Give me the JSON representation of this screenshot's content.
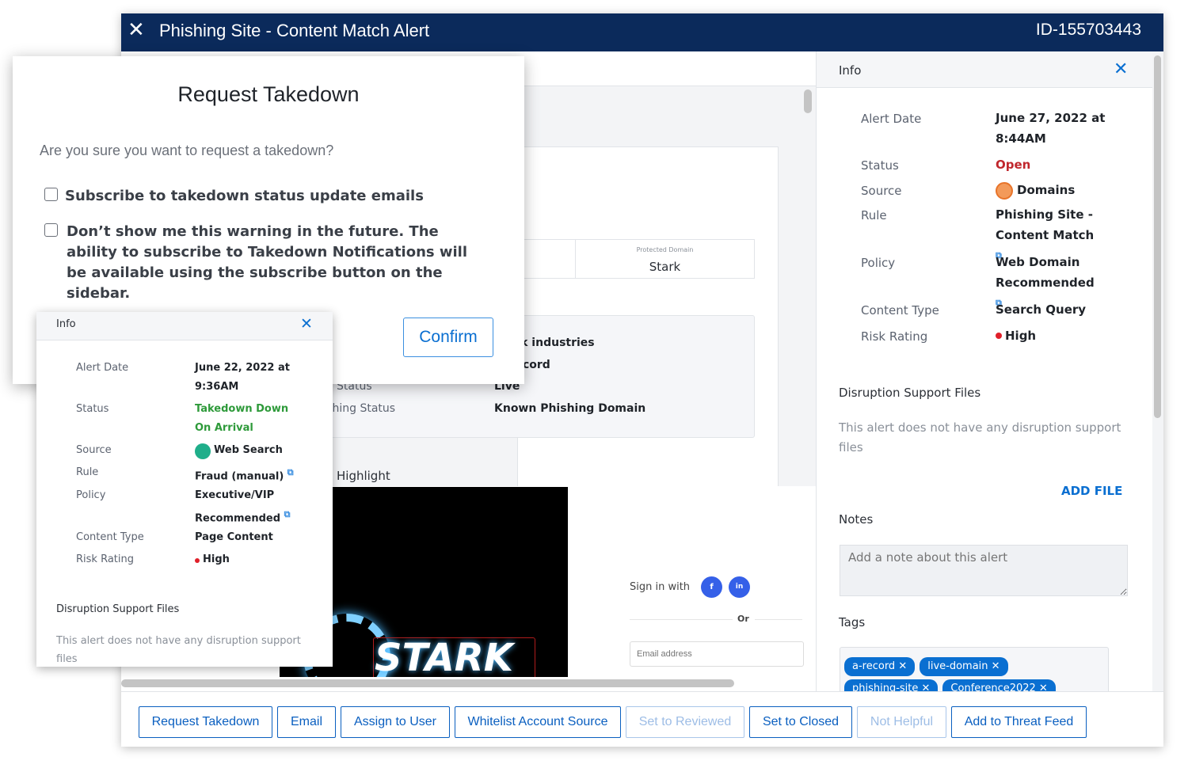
{
  "window": {
    "title": "Phishing Site - Content Match Alert",
    "id": "ID-155703443"
  },
  "middle": {
    "protected_domain_label": "Protected Domain",
    "protected_domain": "Stark",
    "details": [
      {
        "label": "",
        "value": "Stark industries"
      },
      {
        "label": "",
        "value": "A Record"
      },
      {
        "label": "Status",
        "value": "Live"
      },
      {
        "label": "Phishing Status",
        "value": "Known Phishing Domain"
      }
    ],
    "highlight_label": "Highlight",
    "image_text": "STARK",
    "sign_in_label": "Sign in with",
    "facebook": "f",
    "linkedin": "in",
    "or_label": "Or",
    "email_placeholder": "Email address"
  },
  "right_panel": {
    "title": "Info",
    "fields": [
      {
        "label": "Alert Date",
        "value": "June 27, 2022 at 8:44AM"
      },
      {
        "label": "Status",
        "value": "Open"
      },
      {
        "label": "Source",
        "value": "Domains"
      },
      {
        "label": "Rule",
        "value": "Phishing Site - Content Match"
      },
      {
        "label": "Policy",
        "value": "Web Domain Recommended"
      },
      {
        "label": "Content Type",
        "value": "Search Query"
      },
      {
        "label": "Risk Rating",
        "value": "High"
      }
    ],
    "disruption_title": "Disruption Support Files",
    "disruption_text": "This alert does not have any disruption support files",
    "add_file": "ADD FILE",
    "notes_title": "Notes",
    "notes_placeholder": "Add a note about this alert",
    "tags_title": "Tags",
    "tags": [
      "a-record",
      "live-domain",
      "phishing-site",
      "Conference2022"
    ]
  },
  "buttons": [
    "Request Takedown",
    "Email",
    "Assign to User",
    "Whitelist Account Source",
    "Set to Reviewed",
    "Set to Closed",
    "Not Helpful",
    "Add to Threat Feed"
  ],
  "modal": {
    "title": "Request Takedown",
    "question": "Are you sure you want to request a takedown?",
    "subscribe_label": "Subscribe to takedown status update emails",
    "subscribe_checked": false,
    "dont_show_label": "Don’t show me this warning in the future. The ability to subscribe to Takedown Notifications will be available using the subscribe button on the sidebar.",
    "dont_show_checked": false,
    "confirm": "Confirm"
  },
  "small_info": {
    "title": "Info",
    "fields": [
      {
        "label": "Alert Date",
        "value": "June 22, 2022 at 9:36AM"
      },
      {
        "label": "Status",
        "value": "Takedown Down On Arrival"
      },
      {
        "label": "Source",
        "value": "Web Search"
      },
      {
        "label": "Rule",
        "value": "Fraud (manual)"
      },
      {
        "label": "Policy",
        "value": "Executive/VIP Recommended"
      },
      {
        "label": "Content Type",
        "value": "Page Content"
      },
      {
        "label": "Risk Rating",
        "value": "High"
      }
    ],
    "disruption_title": "Disruption Support Files",
    "disruption_text": "This alert does not have any disruption support files"
  },
  "colors": {
    "titlebar": "#0b2a5b",
    "accent": "#0a5fc0",
    "open": "#c0272d",
    "takedown": "#2e9a3a",
    "risk_high": "#e0202a",
    "domains_icon": "#e8742a",
    "web_search_icon": "#1fae8a"
  }
}
